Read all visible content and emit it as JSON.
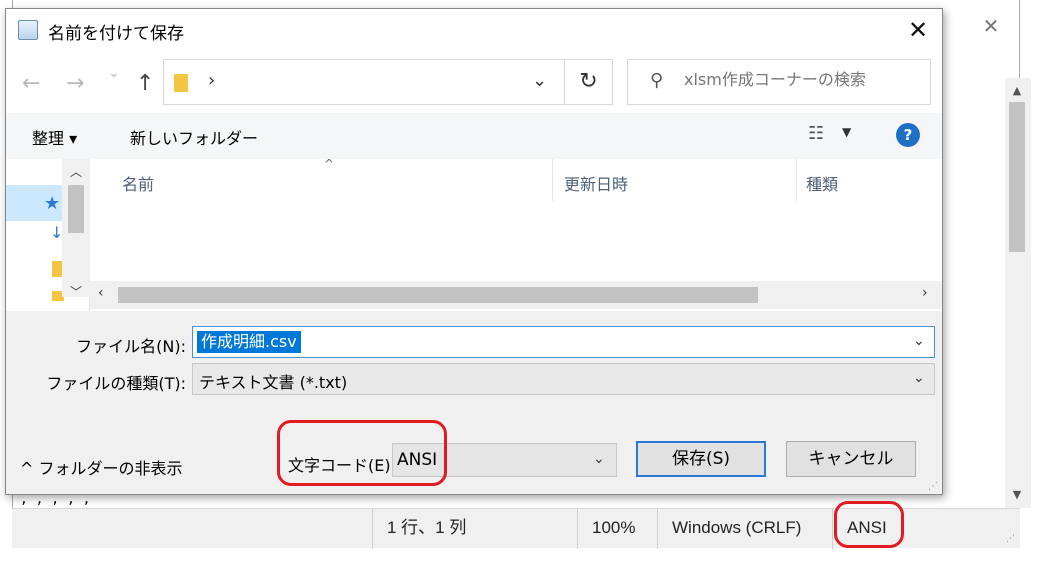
{
  "background_window": {
    "close_glyph": "✕",
    "text_line": ", , , , ,",
    "statusbar": {
      "position": "1 行、1 列",
      "zoom": "100%",
      "line_ending": "Windows (CRLF)",
      "encoding": "ANSI"
    }
  },
  "dialog": {
    "title": "名前を付けて保存",
    "close_glyph": "✕",
    "address": {
      "back_glyph": "←",
      "forward_glyph": "→",
      "recent_glyph": "⌄",
      "up_glyph": "↑",
      "separator": "›",
      "dropdown_glyph": "⌄",
      "refresh_glyph": "↻"
    },
    "search": {
      "placeholder": "xlsm作成コーナーの検索"
    },
    "toolbar": {
      "organize_label": "整理 ▾",
      "new_folder_label": "新しいフォルダー",
      "help_glyph": "?"
    },
    "columns": [
      "名前",
      "更新日時",
      "種類"
    ],
    "file_name_label": "ファイル名(N):",
    "file_name_value": "作成明細.csv",
    "file_type_label": "ファイルの種類(T):",
    "file_type_value": "テキスト文書 (*.txt)",
    "hide_folders_label": "^ フォルダーの非表示",
    "encoding_label": "文字コード(E):",
    "encoding_value": "ANSI",
    "save_label": "保存(S)",
    "cancel_label": "キャンセル"
  },
  "colors": {
    "annotation": "#e01b24",
    "selection": "#0078d7",
    "accent": "#2a7ad5"
  }
}
